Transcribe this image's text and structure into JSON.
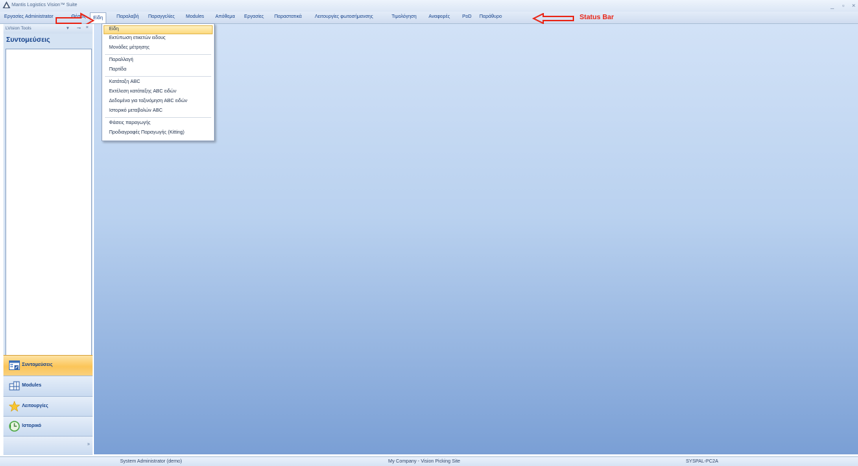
{
  "window": {
    "title": "Mantis Logistics Vision™ Suite",
    "minimize": "_",
    "maximize": "▫",
    "close": "×"
  },
  "menubar": {
    "items": [
      {
        "label": "Εργασίες Administrator"
      },
      {
        "label": "Θέσεις"
      },
      {
        "label": "Είδη"
      },
      {
        "label": "Παραλαβή"
      },
      {
        "label": "Παραγγελίες"
      },
      {
        "label": "Modules"
      },
      {
        "label": "Απόθεμα"
      },
      {
        "label": "Εργασίες"
      },
      {
        "label": "Παραστατικά"
      },
      {
        "label": "Λειτουργίες φωτοσήμανσης"
      },
      {
        "label": "Τιμολόγηση"
      },
      {
        "label": "Αναφορές"
      },
      {
        "label": "PoD"
      },
      {
        "label": "Παράθυρο"
      }
    ],
    "active_item": "Είδη"
  },
  "annotation": {
    "status_bar_label": "Status Bar",
    "color": "#e8281a"
  },
  "dropdown": {
    "items": [
      {
        "label": "Είδη",
        "highlighted": true
      },
      {
        "label": "Εκτύπωση ετικετών ειδους"
      },
      {
        "label": "Μονάδες μέτρησης"
      },
      {
        "label": "Παραλλαγή"
      },
      {
        "label": "Παρτίδα"
      },
      {
        "label": "Κατάταξη ABC"
      },
      {
        "label": "Εκτέλεση κατάταξης ABC ειδών"
      },
      {
        "label": "Δεδομένα για ταξινόμηση ABC ειδών"
      },
      {
        "label": "Ιστορικό μεταβολών ABC"
      },
      {
        "label": "Φάσεις παραγωγής"
      },
      {
        "label": "Προδιαγραφές Παραγωγής (Kitting)"
      }
    ]
  },
  "tools_panel": {
    "header": "LVision Tools",
    "controls": {
      "dropdown": "▾",
      "pin": "⊸",
      "close": "×"
    },
    "pane_title": "Συντομεύσεις",
    "grip": "::::::",
    "nav_buttons": [
      {
        "label": "Συντομεύσεις",
        "icon": "shortcuts-icon",
        "selected": true
      },
      {
        "label": "Modules",
        "icon": "modules-icon"
      },
      {
        "label": "Λειτουργίες",
        "icon": "star-icon"
      },
      {
        "label": "Ιστορικό",
        "icon": "history-icon"
      }
    ],
    "footer_chevron": "»"
  },
  "statusbar": {
    "user": "System Administrator (demo)",
    "company": "My Company - Vision Picking Site",
    "machine": "SYSPAL-PC2A"
  },
  "colors": {
    "accent": "#fbc559",
    "menu_text": "#15428b",
    "mdi_background": "#9dbbe6"
  }
}
